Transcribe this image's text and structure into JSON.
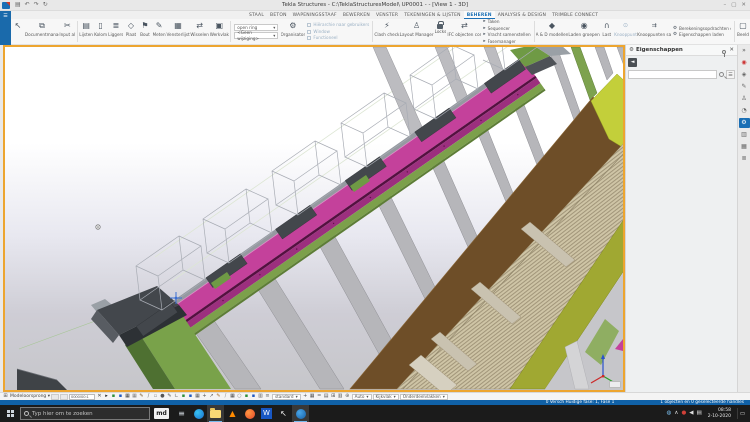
{
  "window": {
    "title_left": "Tekla Structures - C:\\TeklaStructuresModel\\",
    "title_mid": "UP0001 -",
    "title_right": "- [View 1 - 3D]",
    "minimize": "–",
    "maximize": "▢",
    "close": "✕"
  },
  "palette": {
    "accent_blue": "#1A6FB5",
    "viewport_border": "#EDA52F",
    "statusbar_blue": "#1061A7",
    "purlin_magenta": "#C4419B",
    "beam_green": "#7CA04B",
    "beam_brown": "#6E4E28",
    "beam_olive": "#A0A832",
    "deck_beige": "#CFC5A6",
    "rib_gray": "#B6B6BA"
  },
  "icons": {
    "save": "▤",
    "undo": "↶",
    "redo": "↷",
    "refresh": "↻",
    "select": "↖",
    "docmanager": "⧉",
    "cut": "✂",
    "lijsten": "▤",
    "kolom": "▯",
    "liggers": "≣",
    "plaat": "◇",
    "bout": "⚑",
    "meten": "✎",
    "vensterlijst": "▦",
    "wisselen": "⇄",
    "werkvlak": "▣",
    "dropdown": "▾",
    "organisator": "⚙",
    "clash": "⚡",
    "layout": "♙",
    "taken": "▸",
    "sequencer": "▸",
    "vracht": "▸",
    "fase": "▸",
    "adm": "◆",
    "laden": "◉",
    "last": "∩",
    "knooppunt": "⊙",
    "knsam": "⇉",
    "berek": "⚙",
    "eigladen": "⚙",
    "beeld": "▢",
    "gear": "⚙",
    "close": "✕",
    "back": "◄",
    "list": "☰",
    "file_menu": "☰"
  },
  "ribbon": {
    "tabs": [
      {
        "label": "STAAL",
        "active": false
      },
      {
        "label": "BETON",
        "active": false
      },
      {
        "label": "WAPENINGSSTAAF",
        "active": false
      },
      {
        "label": "BEWERKEN",
        "active": false
      },
      {
        "label": "VENSTER",
        "active": false
      },
      {
        "label": "TEKENINGEN & LIJSTEN",
        "active": false
      },
      {
        "label": "BEHEREN",
        "active": true
      },
      {
        "label": "ANALYSIS & DESIGN",
        "active": false
      },
      {
        "label": "TRIMBLE CONNECT",
        "active": false
      }
    ],
    "items": [
      {
        "label": ""
      },
      {
        "label": "Documentmanager"
      },
      {
        "label": "Input al"
      },
      {
        "label": "Lijsten"
      },
      {
        "label": "Kolom"
      },
      {
        "label": "Liggers"
      },
      {
        "label": "Plaat"
      },
      {
        "label": "Bout"
      },
      {
        "label": "Meten"
      },
      {
        "label": "Vensterlijst"
      },
      {
        "label": "Wisselen"
      },
      {
        "label": "Werkvlak"
      },
      {
        "label": "open ring"
      },
      {
        "label": "<Geen wijziging>"
      },
      {
        "label": "Organisator"
      },
      {
        "label": "Hiërarchie naar gebruikers"
      },
      {
        "label": "Window"
      },
      {
        "label": "Functioneel"
      },
      {
        "label": "Clash check"
      },
      {
        "label": "Layout Manager"
      },
      {
        "label": "Locks"
      },
      {
        "label": "IFC objecten converteren"
      },
      {
        "label": "Taken"
      },
      {
        "label": "Sequencer"
      },
      {
        "label": "Vracht samenstellen"
      },
      {
        "label": "Fasemanager"
      },
      {
        "label": "A & D modellen"
      },
      {
        "label": "Laden groepen"
      },
      {
        "label": "Last"
      },
      {
        "label": "Knooppunt"
      },
      {
        "label": "Knooppunten samenvoegen"
      },
      {
        "label": "Berekeningsopdrachten onderzoeken"
      },
      {
        "label": "Eigenschappen laden"
      },
      {
        "label": "Beeld"
      }
    ]
  },
  "panel": {
    "title": "Eigenschappen"
  },
  "side_strip": {
    "icons": [
      {
        "name": "expand-icon",
        "g": "»",
        "c": "#555"
      },
      {
        "name": "tekla-online-icon",
        "g": "◉",
        "c": "#cc3333"
      },
      {
        "name": "notes-icon",
        "g": "◈",
        "c": "#666"
      },
      {
        "name": "edit-icon",
        "g": "✎",
        "c": "#666"
      },
      {
        "name": "user-icon",
        "g": "♙",
        "c": "#666"
      },
      {
        "name": "history-icon",
        "g": "◔",
        "c": "#666"
      },
      {
        "name": "properties-icon",
        "g": "⚙",
        "c": "#fff",
        "active": true
      },
      {
        "name": "components-icon",
        "g": "▥",
        "c": "#666"
      },
      {
        "name": "catalog-icon",
        "g": "▦",
        "c": "#666"
      },
      {
        "name": "layers-icon",
        "g": "≣",
        "c": "#666"
      }
    ]
  },
  "snapbar": {
    "model_origin_label": "Modeloorsprong",
    "coord_value": "0000/00:1",
    "dropdown_standard": "standard",
    "dropdown_auto": "Auto",
    "dropdown_view": "Kijkvlak",
    "dropdown_part": "Onderdeelvlakken",
    "icons1": [
      {
        "name": "clear",
        "g": "✕",
        "c": "#444"
      },
      {
        "name": "snap1",
        "g": "▸",
        "c": "#222"
      },
      {
        "name": "snap2",
        "g": "▪",
        "c": "#2f8f3a"
      },
      {
        "name": "snap3",
        "g": "▪",
        "c": "#2059c0"
      },
      {
        "name": "snap4",
        "g": "▦",
        "c": "#3a3a3a"
      },
      {
        "name": "snap5",
        "g": "▦",
        "c": "#7a7a7a"
      },
      {
        "name": "snap6",
        "g": "✎",
        "c": "#7a5a2a"
      },
      {
        "name": "snap7",
        "g": "/",
        "c": "#666"
      },
      {
        "name": "snap8",
        "g": "▫",
        "c": "#888"
      },
      {
        "name": "snap9",
        "g": "●",
        "c": "#555"
      },
      {
        "name": "snap10",
        "g": "✎",
        "c": "#555"
      },
      {
        "name": "snap11",
        "g": "∟",
        "c": "#555"
      },
      {
        "name": "snap12",
        "g": "▪",
        "c": "#2f8f3a"
      },
      {
        "name": "snap13",
        "g": "▪",
        "c": "#2059c0"
      },
      {
        "name": "snap14",
        "g": "▦",
        "c": "#555"
      },
      {
        "name": "snap15",
        "g": "+",
        "c": "#555"
      },
      {
        "name": "snap16",
        "g": "↗",
        "c": "#555"
      },
      {
        "name": "snap17",
        "g": "✎",
        "c": "#a06a2a"
      },
      {
        "name": "snap18",
        "g": "/",
        "c": "#888"
      },
      {
        "name": "snap19",
        "g": "▦",
        "c": "#444"
      },
      {
        "name": "snap20",
        "g": "○",
        "c": "#777"
      },
      {
        "name": "snap21",
        "g": "▪",
        "c": "#2f8f3a"
      },
      {
        "name": "snap22",
        "g": "▪",
        "c": "#2059c0"
      },
      {
        "name": "snap23",
        "g": "▥",
        "c": "#555"
      },
      {
        "name": "snap24",
        "g": "≡",
        "c": "#666"
      }
    ],
    "icons2": [
      {
        "name": "snapb1",
        "g": "+",
        "c": "#555"
      },
      {
        "name": "snapb2",
        "g": "▦",
        "c": "#555"
      },
      {
        "name": "snapb3",
        "g": "=",
        "c": "#666"
      },
      {
        "name": "snapb4",
        "g": "▤",
        "c": "#555"
      },
      {
        "name": "snapb5",
        "g": "⊞",
        "c": "#555"
      },
      {
        "name": "snapb6",
        "g": "▥",
        "c": "#555"
      },
      {
        "name": "snapb7",
        "g": "⊕",
        "c": "#666"
      }
    ]
  },
  "statusbar": {
    "phase": "0 Versch Huidige fase: 1, Fase 1",
    "selection": "1 objecten en 0 geselecteerde handles"
  },
  "taskbar": {
    "search_placeholder": "Typ hier om te zoeken",
    "badge": "md",
    "apps": [
      {
        "name": "console-app",
        "kind": "glyph",
        "g": "≡",
        "fg": "#cfd6dd",
        "active": false
      },
      {
        "name": "edge-browser",
        "kind": "circle",
        "c1": "#36c3f2",
        "c2": "#1b6fd0",
        "active": false
      },
      {
        "name": "file-explorer",
        "kind": "folder",
        "active": true
      },
      {
        "name": "vlc-player",
        "kind": "glyph",
        "g": "▲",
        "fg": "#ff8a00",
        "active": false
      },
      {
        "name": "firefox-browser",
        "kind": "circle",
        "c1": "#ff9640",
        "c2": "#e3482c",
        "active": false
      },
      {
        "name": "word-app",
        "kind": "glyph",
        "g": "W",
        "fg": "#ffffff",
        "bg": "#1857c4",
        "active": false
      },
      {
        "name": "pointer-app",
        "kind": "glyph",
        "g": "↖",
        "fg": "#eeeeee",
        "active": false
      },
      {
        "name": "tekla-structures-app",
        "kind": "circle",
        "c1": "#49a6e8",
        "c2": "#155ea6",
        "active": true
      }
    ],
    "tray": [
      {
        "name": "network-icon",
        "g": "◍",
        "c": "#7cc0f0"
      },
      {
        "name": "chevron-up-icon",
        "g": "∧",
        "c": "#e0e0e0"
      },
      {
        "name": "alert-icon",
        "g": "●",
        "c": "#d04038"
      },
      {
        "name": "volume-icon",
        "g": "◀",
        "c": "#e0e0e0"
      },
      {
        "name": "language-icon",
        "g": "▤",
        "c": "#e0e0e0"
      }
    ],
    "time": "08:58",
    "date": "2-10-2020"
  }
}
